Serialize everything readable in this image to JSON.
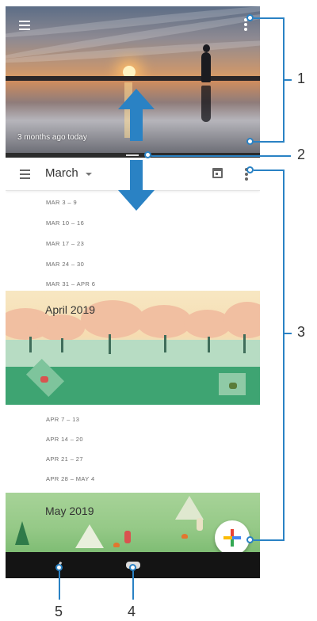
{
  "photo_panel": {
    "caption": "3 months ago today"
  },
  "calendar": {
    "header": {
      "month_label": "March"
    },
    "march_weeks": [
      "MAR 3 – 9",
      "MAR 10 – 16",
      "MAR 17 – 23",
      "MAR 24 – 30",
      "MAR 31 – APR 6"
    ],
    "april_banner": {
      "title": "April 2019"
    },
    "april_weeks": [
      "APR 7 – 13",
      "APR 14 – 20",
      "APR 21 – 27",
      "APR 28 – MAY 4"
    ],
    "may_banner": {
      "title": "May 2019"
    }
  },
  "callouts": {
    "c1": "1",
    "c2": "2",
    "c3": "3",
    "c4": "4",
    "c5": "5"
  },
  "icons": {
    "photo_menu": "hamburger-menu-icon",
    "photo_more": "vertical-dots-icon",
    "calendar_menu": "hamburger-menu-icon",
    "calendar_today": "calendar-today-icon",
    "calendar_more": "vertical-dots-icon",
    "fab": "plus-icon",
    "nav_back": "back-icon",
    "nav_home": "home-icon"
  },
  "colors": {
    "accent_blue": "#2a82c4",
    "fab_red": "#ea4335",
    "fab_green": "#34a853",
    "fab_yellow": "#fbbc04",
    "fab_blue": "#4285f4"
  }
}
